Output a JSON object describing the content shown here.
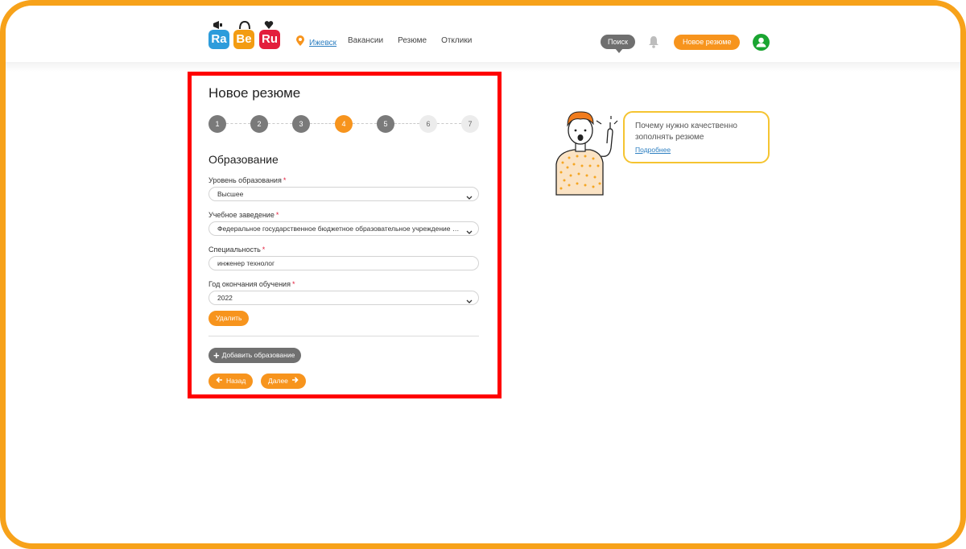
{
  "header": {
    "logo": {
      "letters": [
        "Ra",
        "Be",
        "Ru"
      ]
    },
    "location": "Ижевск",
    "nav": [
      "Вакансии",
      "Резюме",
      "Отклики"
    ],
    "search_label": "Поиск",
    "new_resume_label": "Новое резюме"
  },
  "form": {
    "title": "Новое резюме",
    "steps": [
      "1",
      "2",
      "3",
      "4",
      "5",
      "6",
      "7"
    ],
    "current_step": 4,
    "section_title": "Образование",
    "fields": {
      "level": {
        "label": "Уровень образования",
        "value": "Высшее"
      },
      "institution": {
        "label": "Учебное заведение",
        "value": "Федеральное государственное бюджетное образовательное учреждение высшего образования"
      },
      "specialty": {
        "label": "Специальность",
        "value": "инженер технолог"
      },
      "graduation_year": {
        "label": "Год окончания обучения",
        "value": "2022"
      }
    },
    "required_mark": "*",
    "delete_label": "Удалить",
    "add_education_label": "Добавить образование",
    "back_label": "Назад",
    "next_label": "Далее"
  },
  "hint": {
    "text": "Почему нужно качественно зополнять резюме",
    "link": "Подробнее"
  },
  "colors": {
    "accent": "#f7941d",
    "highlight_border": "#ff0000",
    "frame": "#f7a21a",
    "avatar": "#1aa531",
    "link": "#2d7fc1"
  }
}
